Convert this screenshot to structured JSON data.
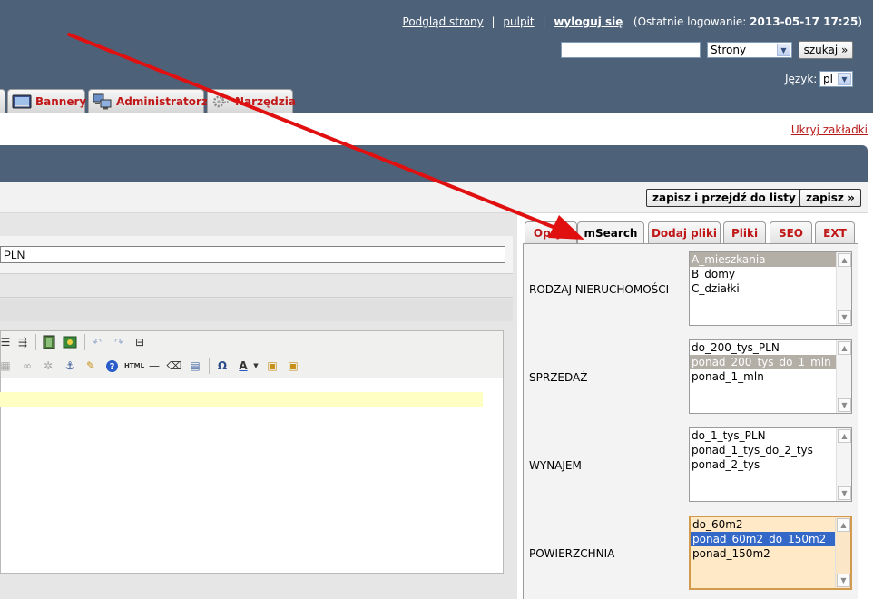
{
  "header": {
    "links": {
      "preview": "Podgląd strony",
      "sep1": "|",
      "desktop": "pulpit",
      "sep2": "|",
      "logout": "wyloguj się",
      "last_login_prefix": "(Ostatnie logowanie:",
      "last_login_value": "2013-05-17 17:25",
      "last_login_suffix": ")"
    },
    "search": {
      "value": "",
      "type": "Strony",
      "button": "szukaj »"
    },
    "language": {
      "label": "Język:",
      "value": "pl"
    }
  },
  "main_tabs": [
    {
      "label": "Bannery",
      "icon": "banner-icon"
    },
    {
      "label": "Administratorzy",
      "icon": "computers-icon"
    },
    {
      "label": "Narzędzia",
      "icon": "gears-icon"
    }
  ],
  "hide_tabs_link": "Ukryj zakładki",
  "actions": {
    "save_and_list": "zapisz i przejdź do listy »",
    "save": "zapisz »"
  },
  "form": {
    "price_value": "PLN"
  },
  "side_tabs": [
    {
      "label": "Opcje",
      "active": false
    },
    {
      "label": "mSearch",
      "active": true
    },
    {
      "label": "Dodaj pliki",
      "active": false
    },
    {
      "label": "Pliki",
      "active": false
    },
    {
      "label": "SEO",
      "active": false
    },
    {
      "label": "EXT",
      "active": false
    }
  ],
  "msearch_fields": [
    {
      "label": "RODZAJ NIERUCHOMOŚCI",
      "options": [
        "A_mieszkania",
        "B_domy",
        "C_działki"
      ],
      "selected": 0,
      "focused": false
    },
    {
      "label": "SPRZEDAŻ",
      "options": [
        "do_200_tys_PLN",
        "ponad_200_tys_do_1_mln",
        "ponad_1_mln"
      ],
      "selected": 1,
      "focused": false
    },
    {
      "label": "WYNAJEM",
      "options": [
        "do_1_tys_PLN",
        "ponad_1_tys_do_2_tys",
        "ponad_2_tys"
      ],
      "selected": -1,
      "focused": false
    },
    {
      "label": "POWIERZCHNIA",
      "options": [
        "do_60m2",
        "ponad_60m2_do_150m2",
        "ponad_150m2"
      ],
      "selected": 1,
      "focused": true
    }
  ],
  "colors": {
    "header_bg": "#4d6179",
    "tab_text_red": "#c01818",
    "arrow_red": "#e01010",
    "selection_blue": "#3468c8"
  }
}
